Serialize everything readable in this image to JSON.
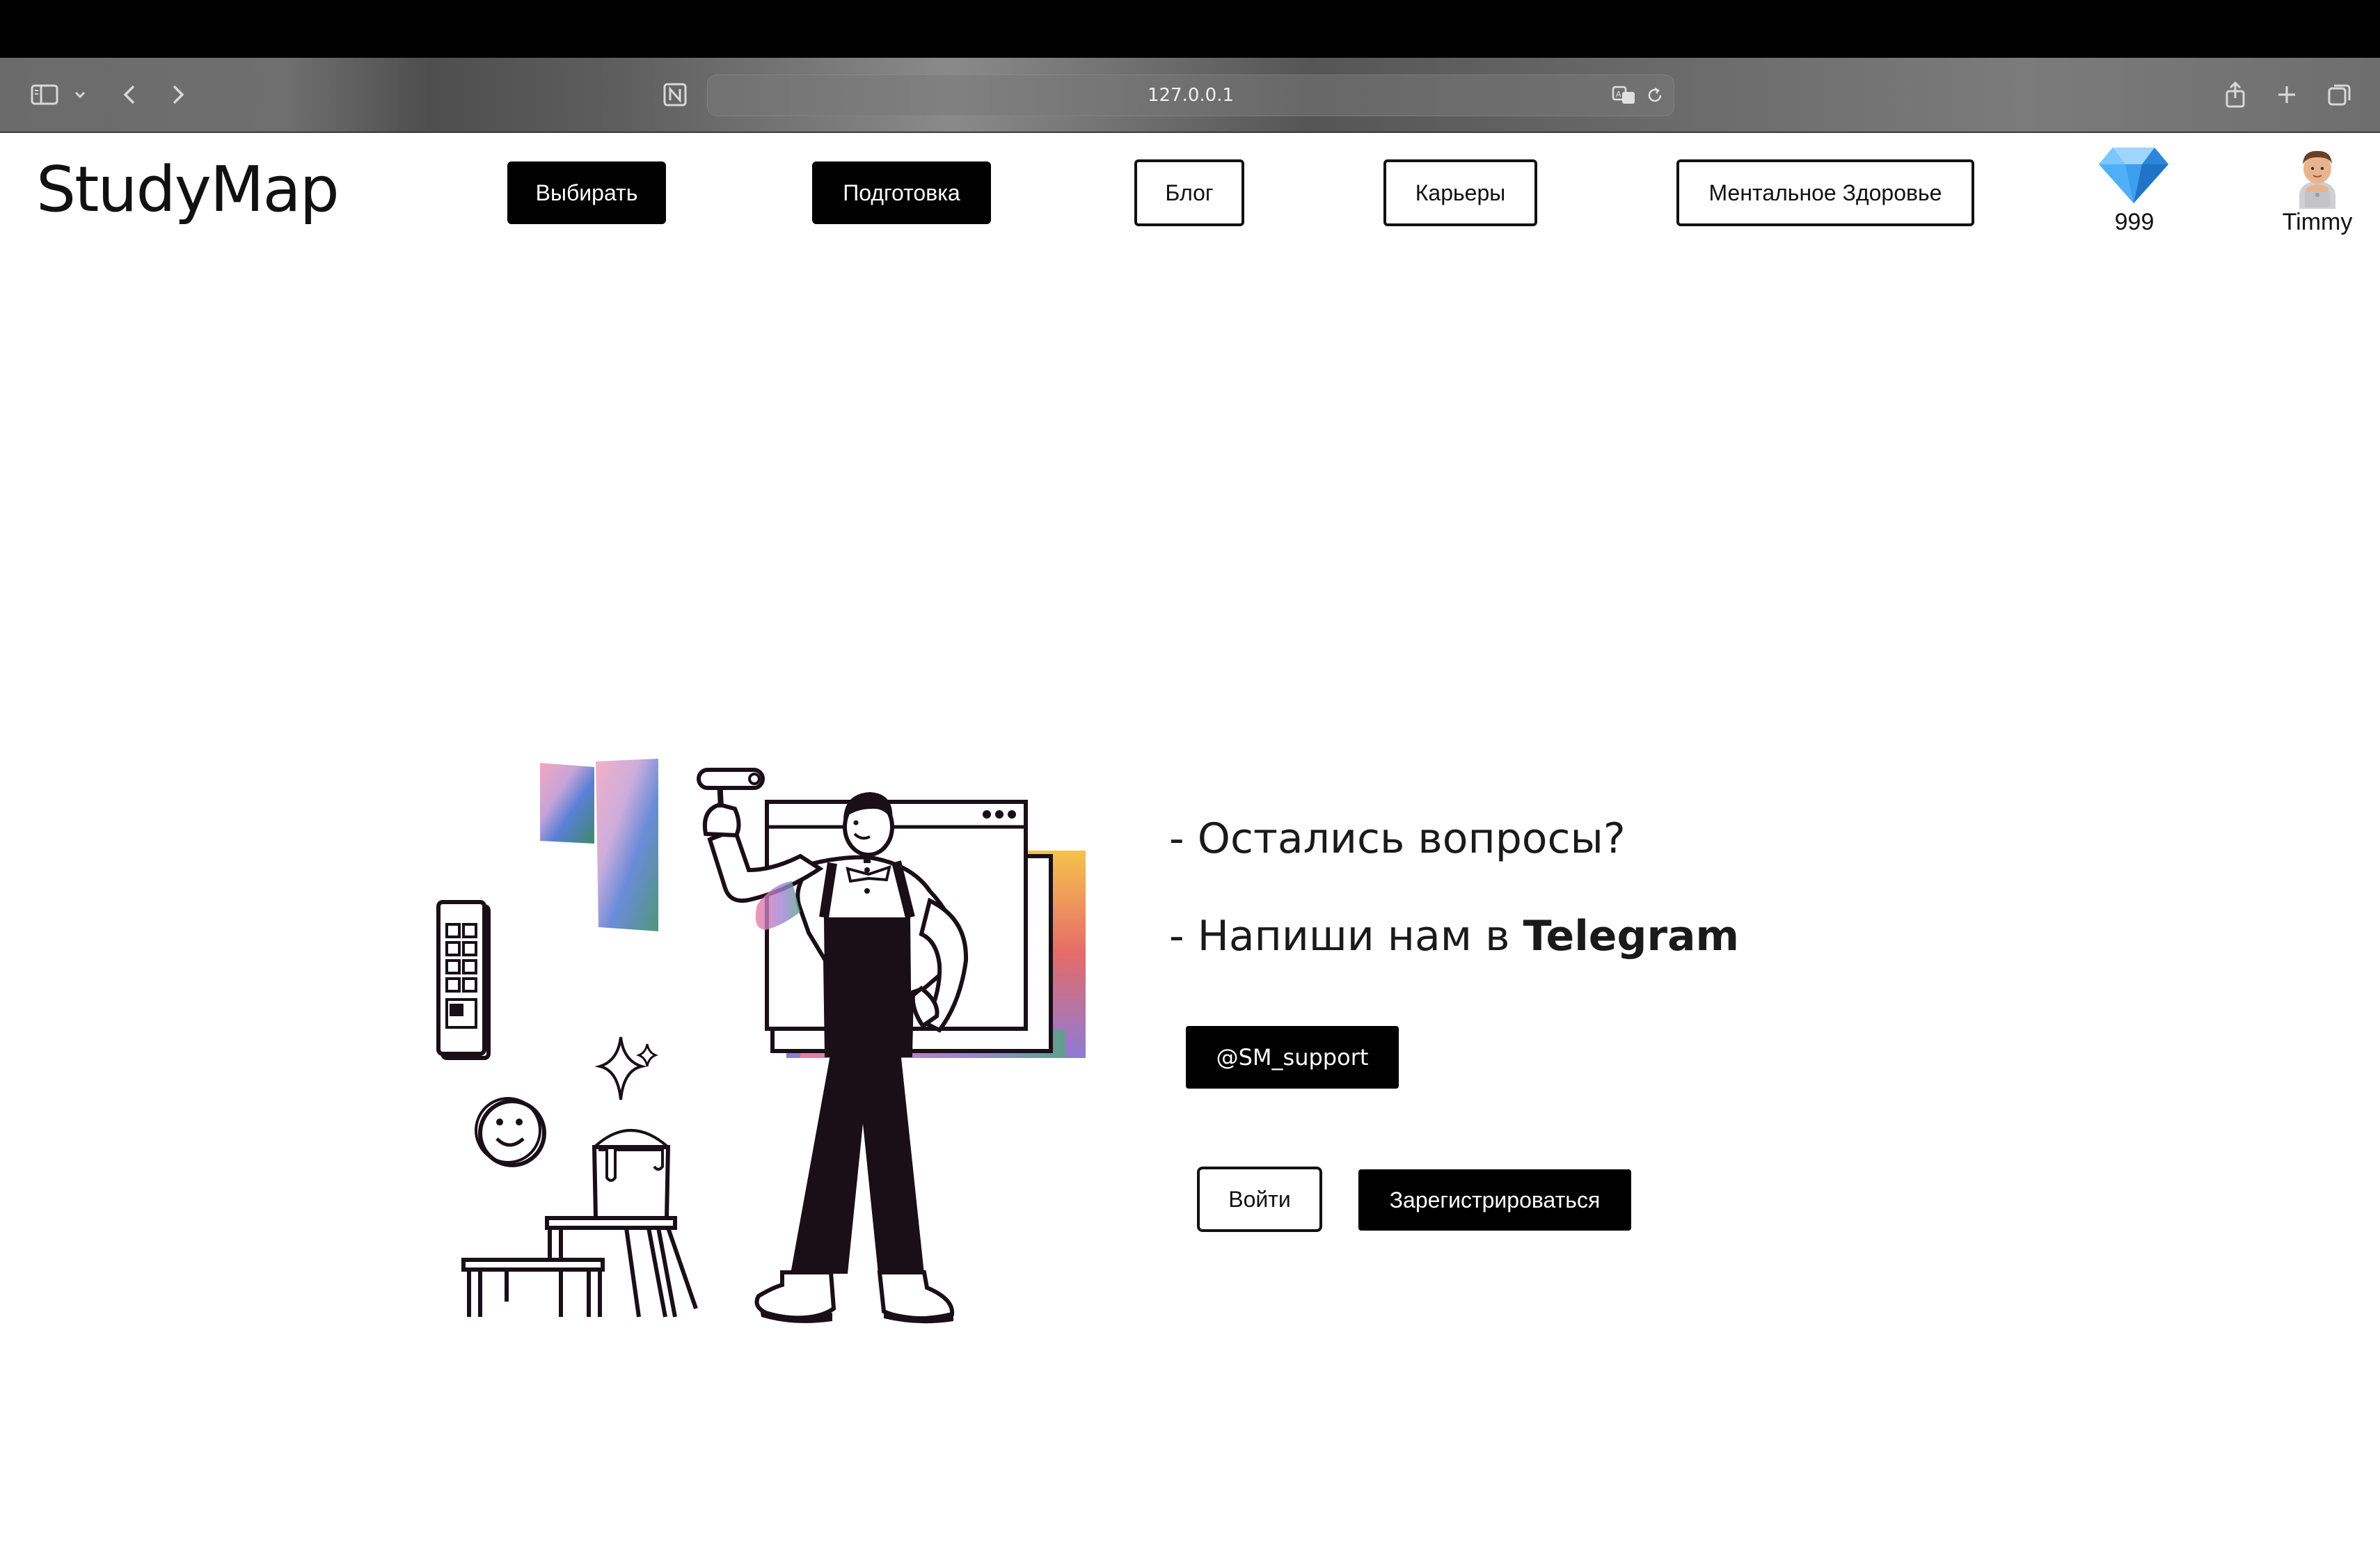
{
  "browser": {
    "url": "127.0.0.1",
    "icons": [
      "sidebar-icon",
      "chevron-down-icon",
      "back-icon",
      "forward-icon",
      "notion-icon",
      "translate-icon",
      "reload-icon",
      "share-icon",
      "new-tab-icon",
      "tabs-overview-icon"
    ]
  },
  "header": {
    "logo": "StudyMap",
    "nav": [
      {
        "label": "Выбирать",
        "style": "dark"
      },
      {
        "label": "Подготовка",
        "style": "dark"
      },
      {
        "label": "Блог",
        "style": "outline"
      },
      {
        "label": "Карьеры",
        "style": "outline"
      },
      {
        "label": "Ментальное Здоровье",
        "style": "outline"
      }
    ],
    "gems": "999",
    "user_name": "Timmy"
  },
  "main": {
    "line1": "- Остались вопросы?",
    "line2_prefix": "- Напиши нам в ",
    "line2_strong": "Telegram",
    "telegram_handle": "@SM_support",
    "login_label": "Войти",
    "register_label": "Зарегистрироваться"
  },
  "colors": {
    "accent": "#000000",
    "page_bg": "#ffffff",
    "gem": "#3aa0f5"
  }
}
